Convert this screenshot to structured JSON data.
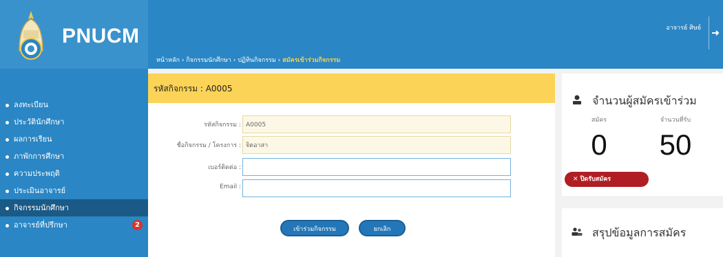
{
  "brand": {
    "name": "PNUCM"
  },
  "sidebar": {
    "items": [
      {
        "label": "ลงทะเบียน",
        "active": false
      },
      {
        "label": "ประวัตินักศึกษา",
        "active": false
      },
      {
        "label": "ผลการเรียน",
        "active": false
      },
      {
        "label": "ภาพักการศึกษา",
        "active": false
      },
      {
        "label": "ความประพฤติ",
        "active": false
      },
      {
        "label": "ประเมินอาจารย์",
        "active": false
      },
      {
        "label": "กิจกรรมนักศึกษา",
        "active": true
      },
      {
        "label": "อาจารย์ที่ปรึกษา",
        "active": false,
        "badge": "2"
      }
    ]
  },
  "header": {
    "user": "อาจารย์ ศิษย์",
    "breadcrumb": {
      "path": "หน้าหลัก › กิจกรรมนักศึกษา › ปฏิทินกิจกรรม › ",
      "current": "สมัครเข้าร่วมกิจกรรม"
    }
  },
  "form": {
    "title": "รหัสกิจกรรม : A0005",
    "fields": {
      "activity_code": {
        "label": "รหัสกิจกรรม :",
        "value": "A0005"
      },
      "activity_name": {
        "label": "ชื่อกิจกรรม / โครงการ :",
        "value": "จิตอาสา"
      },
      "phone": {
        "label": "เบอร์ติดต่อ :",
        "value": ""
      },
      "email": {
        "label": "Email :",
        "value": ""
      }
    },
    "join_button": "เข้าร่วมกิจกรรม",
    "cancel_button": "ยกเลิก"
  },
  "applicants_widget": {
    "title": "จำนวนผู้สมัครเข้าร่วม",
    "applied_label": "สมัคร",
    "applied_value": "0",
    "capacity_label": "จำนวนที่รับ",
    "capacity_value": "50",
    "status_badge": "ปิดรับสมัคร"
  },
  "summary_widget": {
    "title": "สรุปข้อมูลการสมัคร"
  },
  "colors": {
    "primary": "#2a86c4",
    "active_menu": "#1b5a86",
    "panel_header": "#fbd356",
    "closed_badge": "#b01e23"
  }
}
